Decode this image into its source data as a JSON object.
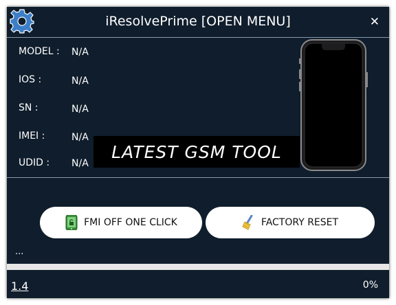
{
  "window": {
    "title": "iResolvePrime [OPEN MENU]",
    "close_label": "✕"
  },
  "device_info": [
    {
      "label": "MODEL :",
      "value": "N/A"
    },
    {
      "label": "IOS :",
      "value": "N/A"
    },
    {
      "label": "SN :",
      "value": "N/A"
    },
    {
      "label": "IMEI :",
      "value": "N/A"
    },
    {
      "label": "UDID :",
      "value": "N/A"
    }
  ],
  "banner": {
    "text": "LATEST GSM TOOL"
  },
  "buttons": {
    "fmi_off_label": "FMI OFF ONE CLICK",
    "factory_reset_label": "FACTORY RESET"
  },
  "status": {
    "text": "..."
  },
  "progress": {
    "value": 0,
    "percent_label": "0%",
    "fill_color": "#2e8b57"
  },
  "footer": {
    "version": "1.4"
  },
  "colors": {
    "background": "#0f1d2c",
    "banner_background": "#000000",
    "button_background": "#ffffff"
  },
  "icons": {
    "menu": "gear-icon",
    "close": "close-icon",
    "fmi": "phone-unlock-icon",
    "reset": "broom-icon",
    "device": "iphone-icon"
  }
}
